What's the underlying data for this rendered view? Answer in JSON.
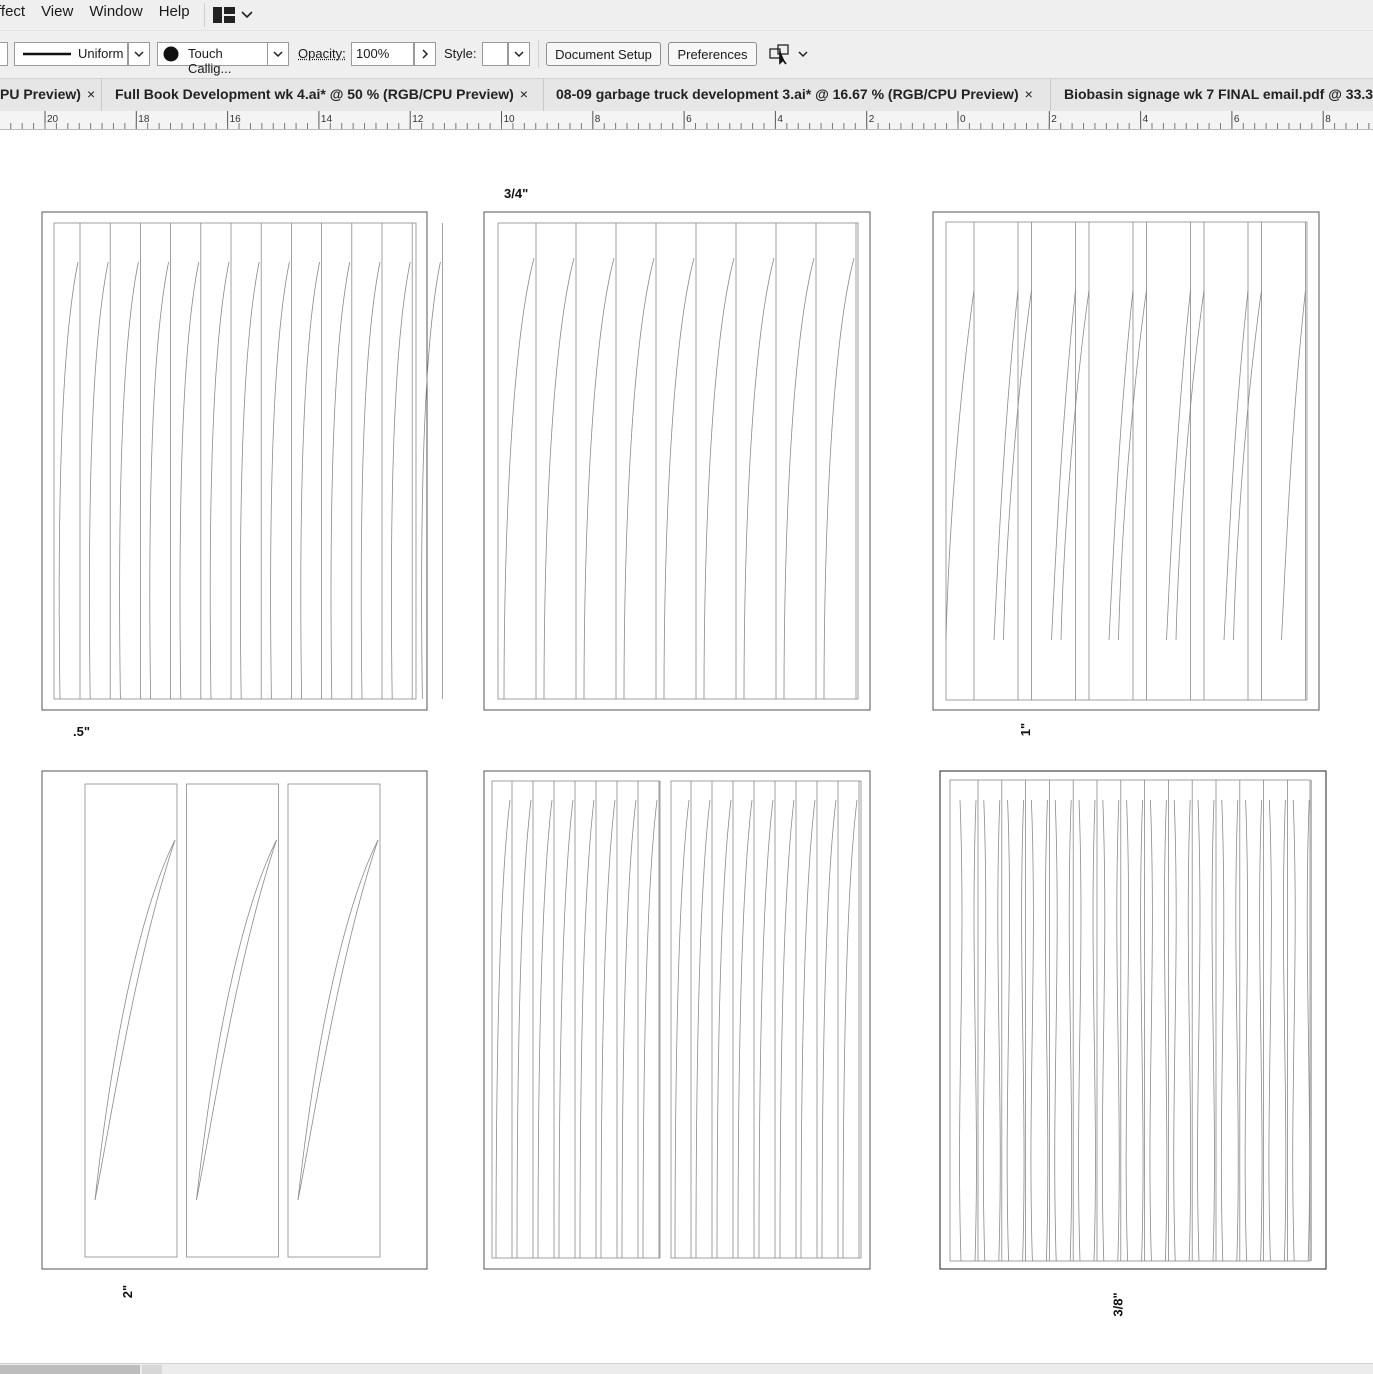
{
  "menu": {
    "items": [
      "ffect",
      "View",
      "Window",
      "Help"
    ]
  },
  "control_bar": {
    "stroke_profile": "Uniform",
    "brush_name": "Touch Callig...",
    "opacity_label": "Opacity:",
    "opacity_value": "100%",
    "style_label": "Style:",
    "document_setup": "Document Setup",
    "preferences": "Preferences"
  },
  "tabs": [
    {
      "label": "PU Preview)",
      "close": "×"
    },
    {
      "label": "Full Book Development wk 4.ai* @ 50 % (RGB/CPU Preview)",
      "close": "×"
    },
    {
      "label": "08-09 garbage truck development  3.ai* @ 16.67 % (RGB/CPU Preview)",
      "close": "×"
    },
    {
      "label": "Biobasin signage wk 7 FINAL email.pdf @ 33.3"
    }
  ],
  "ruler": {
    "labels": [
      "20",
      "18",
      "16",
      "14",
      "12",
      "10",
      "8",
      "6",
      "4",
      "2",
      "0",
      "2",
      "4",
      "6",
      "8"
    ]
  },
  "artboard_annotations": {
    "half_inch": ".5\"",
    "three_quarter_inch": "3/4\"",
    "one_inch": "1\"",
    "two_inch": "2\"",
    "three_eighths_inch": "3/8\""
  },
  "icons": {
    "workspace": "workspace-grid-icon",
    "arrange": "arrange-documents-icon",
    "brush": "brush-dot-icon"
  }
}
